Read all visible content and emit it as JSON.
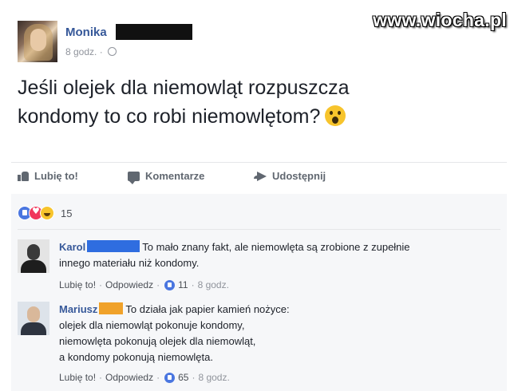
{
  "watermark": "www.wiocha.pl",
  "post": {
    "author": "Monika",
    "time": "8 godz.",
    "text_line1": "Jeśli olejek dla niemowląt rozpuszcza",
    "text_line2": "kondomy to co robi niemowlętom?"
  },
  "actions": {
    "like": "Lubię to!",
    "comment": "Komentarze",
    "share": "Udostępnij"
  },
  "reactions": {
    "count": "15"
  },
  "comments": [
    {
      "author": "Karol",
      "redact_color": "#2f6de0",
      "line1": "To mało znany fakt, ale niemowlęta są zrobione z zupełnie",
      "line2": "innego materiału niż kondomy.",
      "like": "Lubię to!",
      "reply": "Odpowiedz",
      "likes": "11",
      "time": "8 godz."
    },
    {
      "author": "Mariusz",
      "redact_color": "#f0a22a",
      "line1": "To działa jak papier kamień nożyce:",
      "line2": "olejek dla niemowląt pokonuje kondomy,",
      "line3": "niemowlęta pokonują olejek dla niemowląt,",
      "line4": "a kondomy pokonują niemowlęta.",
      "like": "Lubię to!",
      "reply": "Odpowiedz",
      "likes": "65",
      "time": "8 godz."
    }
  ]
}
